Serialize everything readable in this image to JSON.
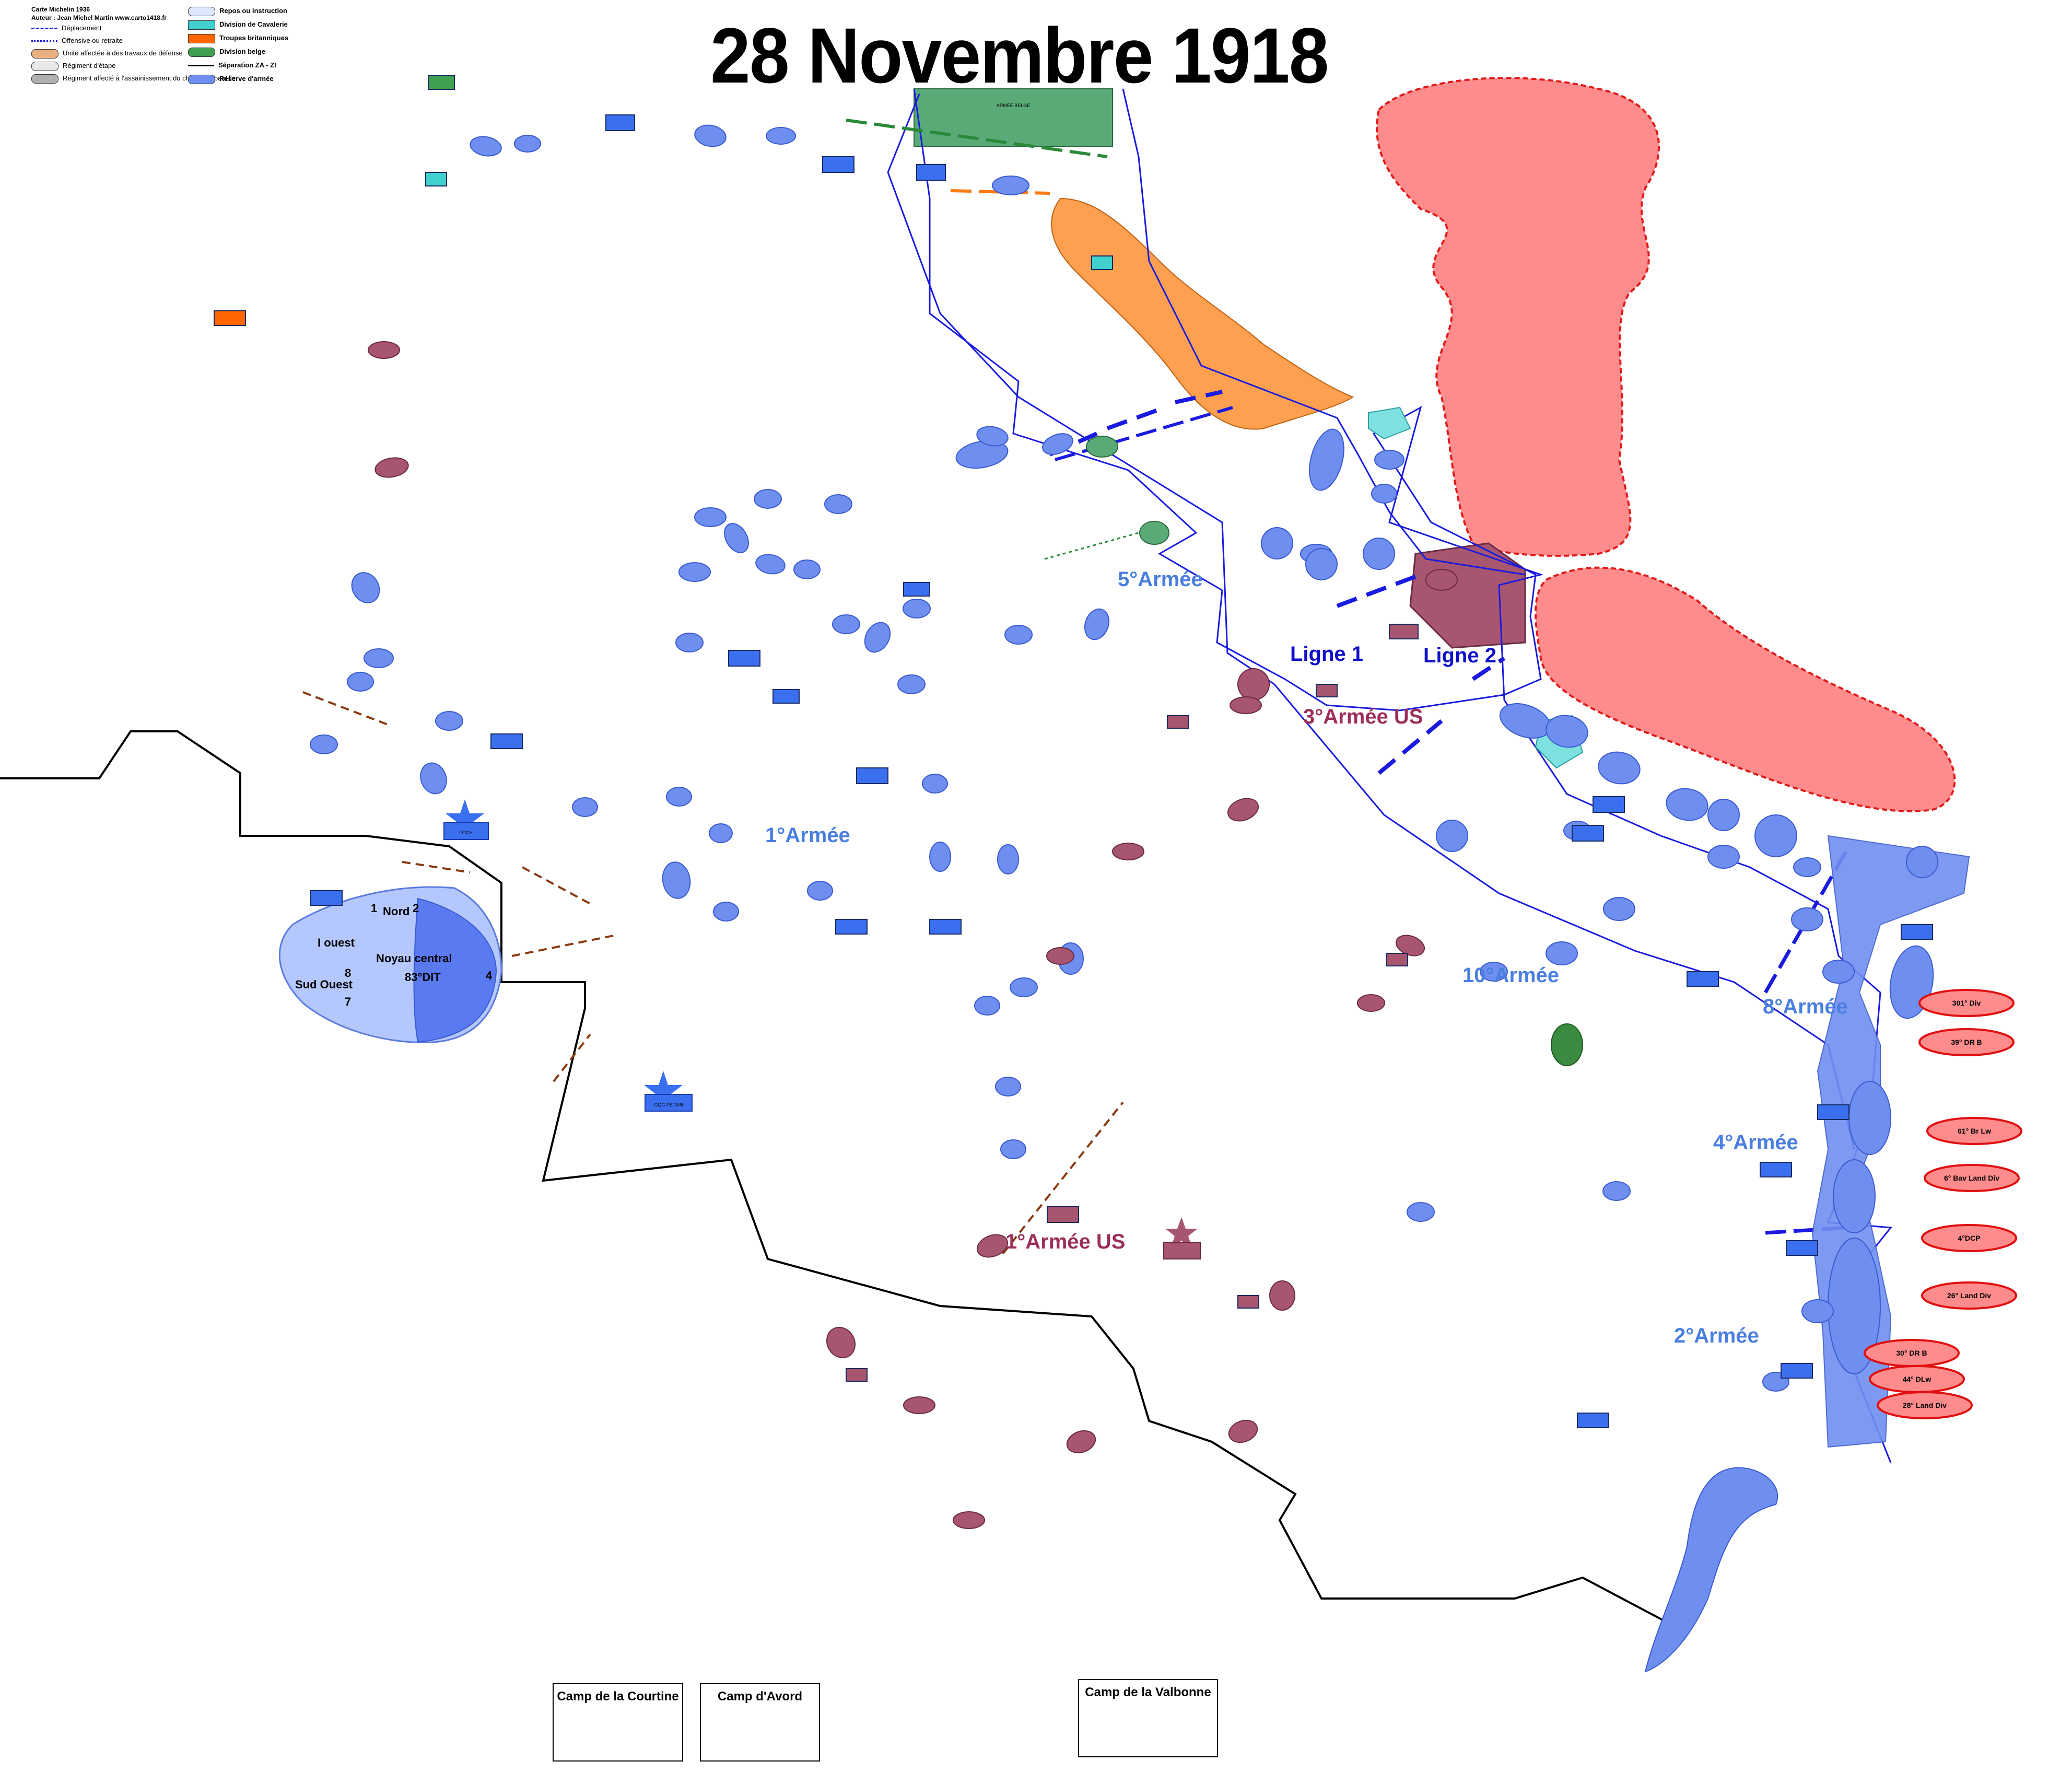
{
  "title": "28 Novembre 1918",
  "legend": {
    "credits": [
      "Carte Michelin 1936",
      "Auteur : Jean Michel Martin   www.carto1418.fr"
    ],
    "left": [
      {
        "label": "Déplacement",
        "icon": "dashed-arrow-icon"
      },
      {
        "label": "Offensive ou retraite",
        "icon": "dotted-arrow-icon"
      },
      {
        "label": "Unité affectée à des travaux de défense",
        "icon": "defense-work-icon"
      },
      {
        "label": "Régiment d'étape",
        "icon": "stage-regiment-icon"
      },
      {
        "label": "Régiment affecté à l'assainissement du champ de bataille",
        "icon": "sanitation-regiment-icon"
      }
    ],
    "right": [
      {
        "label": "Repos ou instruction",
        "color": "#dde8ff"
      },
      {
        "label": "Division de Cavalerie",
        "color": "#40d0d0"
      },
      {
        "label": "Troupes britanniques",
        "color": "#ff6600"
      },
      {
        "label": "Division belge",
        "color": "#3fa050"
      },
      {
        "label": "Séparation ZA - ZI",
        "color": "#000000"
      },
      {
        "label": "Réserve d'armée",
        "color": "#6f8ff0"
      }
    ]
  },
  "armies": {
    "a1": "1°Armée",
    "a5": "5°Armée",
    "a10": "10°Armée",
    "a8": "8°Armée",
    "a4": "4°Armée",
    "a2": "2°Armée",
    "us1": "1°Armée US",
    "us3": "3°Armée US"
  },
  "lines": {
    "l1": "Ligne 1",
    "l2": "Ligne 2"
  },
  "german_units": [
    "301° Div",
    "39° DR B",
    "61° Br Lw",
    "6° Bav Land Div",
    "4°DCP",
    "26° Land Div",
    "30° DR B",
    "44° DLw",
    "28° Land Div"
  ],
  "paris_sectors": {
    "n1": "1",
    "n2": "2",
    "nord": "Nord",
    "ouest": "I ouest",
    "central": "Noyau central",
    "sudouest": "Sud Ouest",
    "n8": "8",
    "n7": "7",
    "n4": "4",
    "dit": "83°DIT"
  },
  "hq": {
    "gqg": "GQG PETAIN",
    "foch": "FOCH",
    "belgian": "ARMEE BELGE"
  },
  "camps": [
    "Camp de la Courtine",
    "Camp d'Avord",
    "Camp de la Valbonne"
  ],
  "colors": {
    "french": "#6f8ff0",
    "french_dark": "#3a6ff0",
    "us": "#a8556f",
    "german_zone": "#ff8c8c",
    "british": "#ffa050",
    "belgian": "#5aaa78",
    "cavalry": "#7fe0e0",
    "front": "#1a1ae0"
  }
}
